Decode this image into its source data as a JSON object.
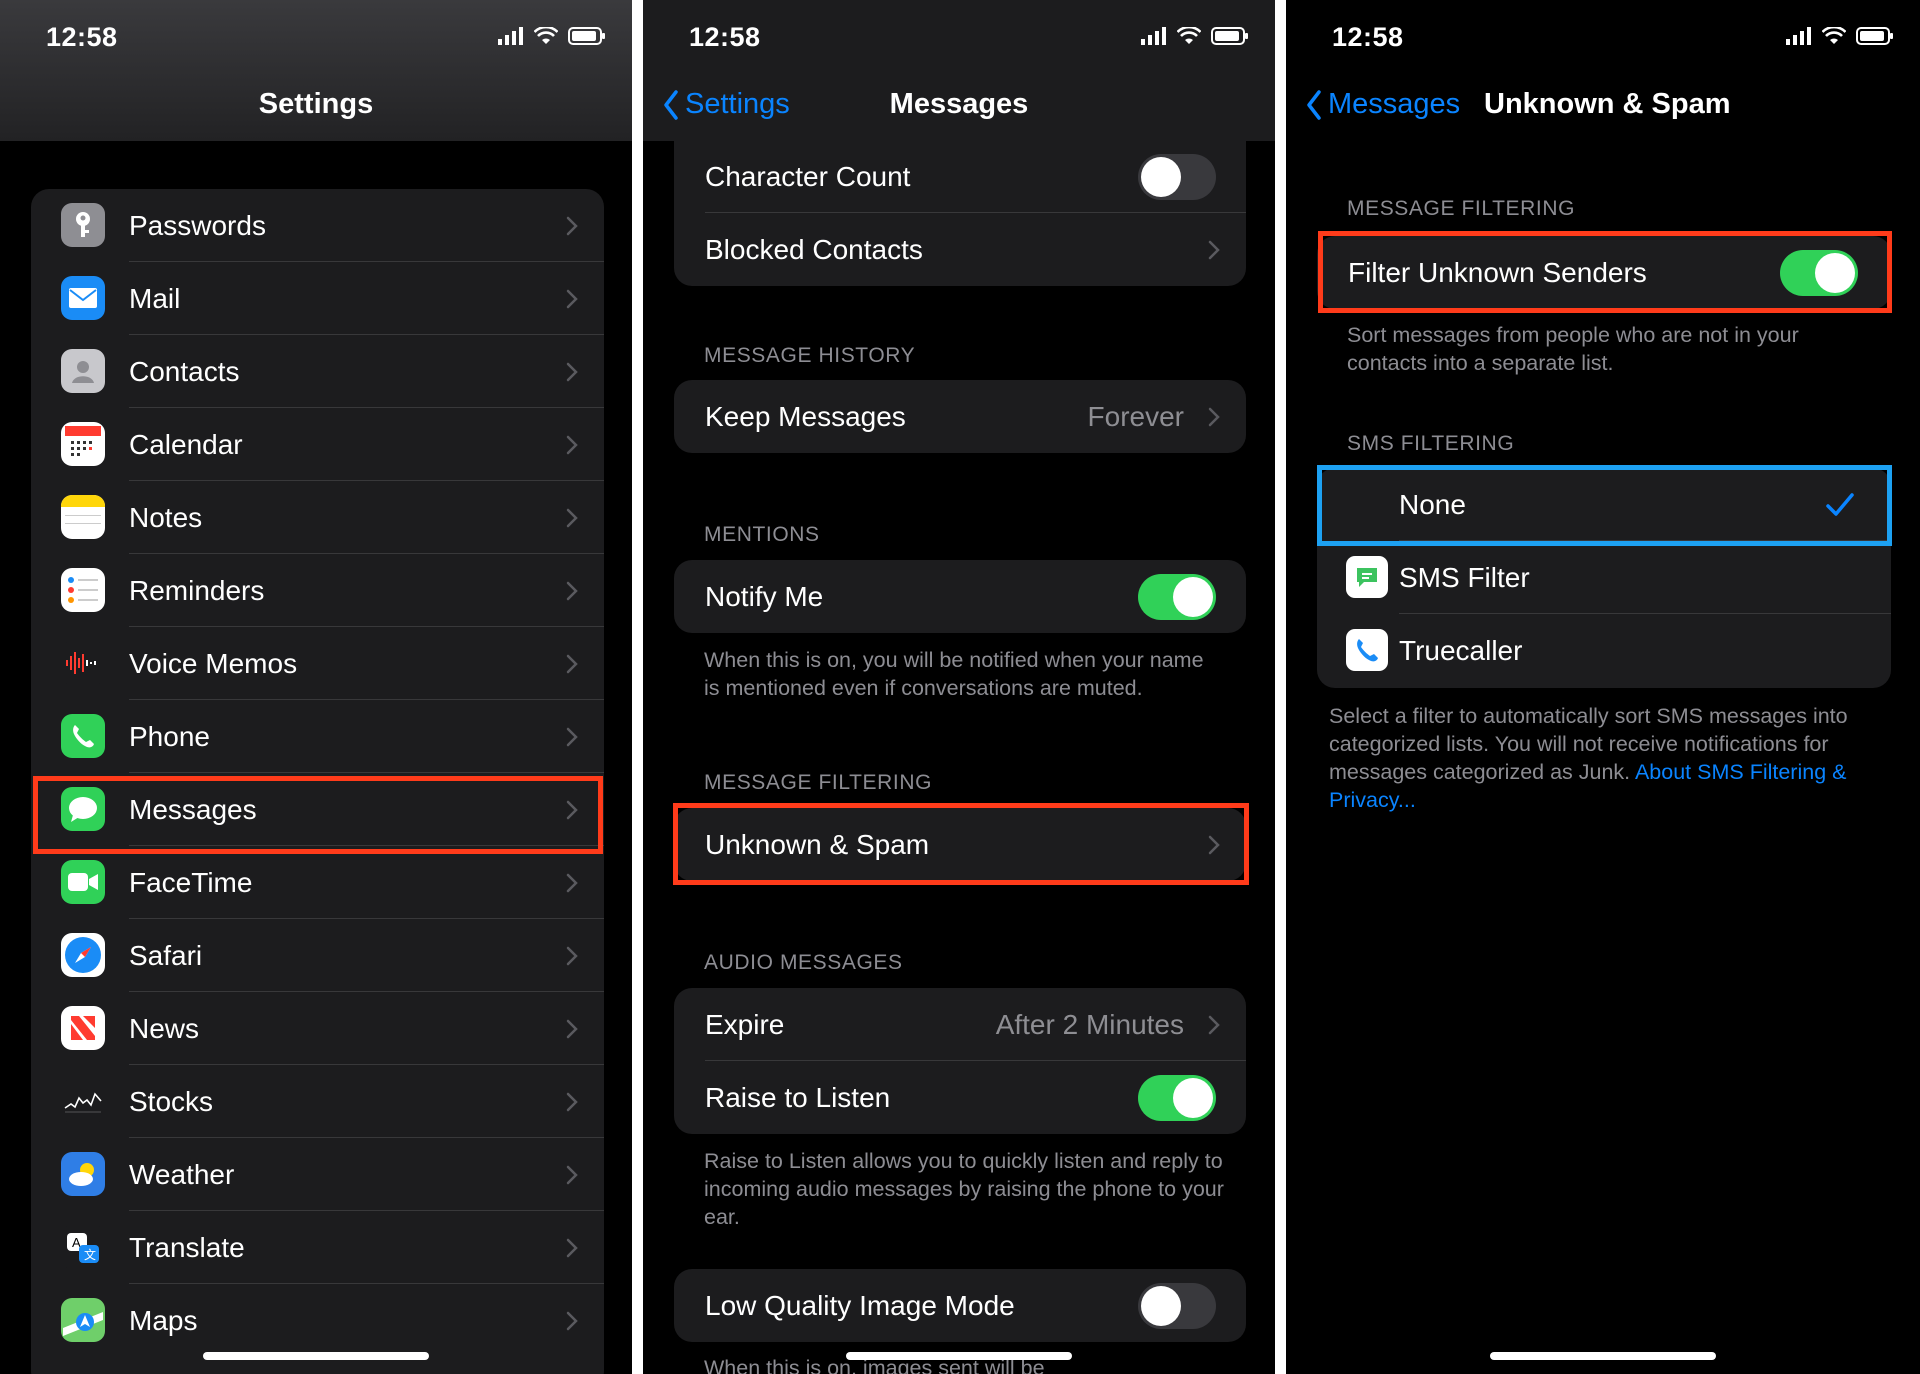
{
  "status": {
    "time": "12:58"
  },
  "screen1": {
    "title": "Settings",
    "items": [
      {
        "label": "Passwords",
        "icon": "key-icon"
      },
      {
        "label": "Mail",
        "icon": "mail-icon"
      },
      {
        "label": "Contacts",
        "icon": "contacts-icon"
      },
      {
        "label": "Calendar",
        "icon": "calendar-icon"
      },
      {
        "label": "Notes",
        "icon": "notes-icon"
      },
      {
        "label": "Reminders",
        "icon": "reminders-icon"
      },
      {
        "label": "Voice Memos",
        "icon": "voice-memos-icon"
      },
      {
        "label": "Phone",
        "icon": "phone-icon"
      },
      {
        "label": "Messages",
        "icon": "messages-icon"
      },
      {
        "label": "FaceTime",
        "icon": "facetime-icon"
      },
      {
        "label": "Safari",
        "icon": "safari-icon"
      },
      {
        "label": "News",
        "icon": "news-icon"
      },
      {
        "label": "Stocks",
        "icon": "stocks-icon"
      },
      {
        "label": "Weather",
        "icon": "weather-icon"
      },
      {
        "label": "Translate",
        "icon": "translate-icon"
      },
      {
        "label": "Maps",
        "icon": "maps-icon"
      }
    ]
  },
  "screen2": {
    "back": "Settings",
    "title": "Messages",
    "character_count": "Character Count",
    "blocked_contacts": "Blocked Contacts",
    "history_header": "MESSAGE HISTORY",
    "keep_messages": "Keep Messages",
    "keep_value": "Forever",
    "mentions_header": "MENTIONS",
    "notify_me": "Notify Me",
    "notify_footer": "When this is on, you will be notified when your name is mentioned even if conversations are muted.",
    "filtering_header": "MESSAGE FILTERING",
    "unknown_spam": "Unknown & Spam",
    "audio_header": "AUDIO MESSAGES",
    "expire": "Expire",
    "expire_value": "After 2 Minutes",
    "raise_to_listen": "Raise to Listen",
    "raise_footer": "Raise to Listen allows you to quickly listen and reply to incoming audio messages by raising the phone to your ear.",
    "low_quality": "Low Quality Image Mode",
    "low_quality_footer": "When this is on, images sent will be"
  },
  "screen3": {
    "back": "Messages",
    "title": "Unknown & Spam",
    "filtering_header": "MESSAGE FILTERING",
    "filter_unknown": "Filter Unknown Senders",
    "filter_footer": "Sort messages from people who are not in your contacts into a separate list.",
    "sms_header": "SMS FILTERING",
    "options": [
      "None",
      "SMS Filter",
      "Truecaller"
    ],
    "sms_footer": "Select a filter to automatically sort SMS messages into categorized lists. You will not receive notifications for messages categorized as Junk.",
    "sms_link": "About SMS Filtering & Privacy..."
  },
  "colors": {
    "accent": "#0a84ff",
    "toggle_on": "#30d158",
    "highlight_red": "#ff3b1a",
    "highlight_blue": "#1da1f2"
  }
}
